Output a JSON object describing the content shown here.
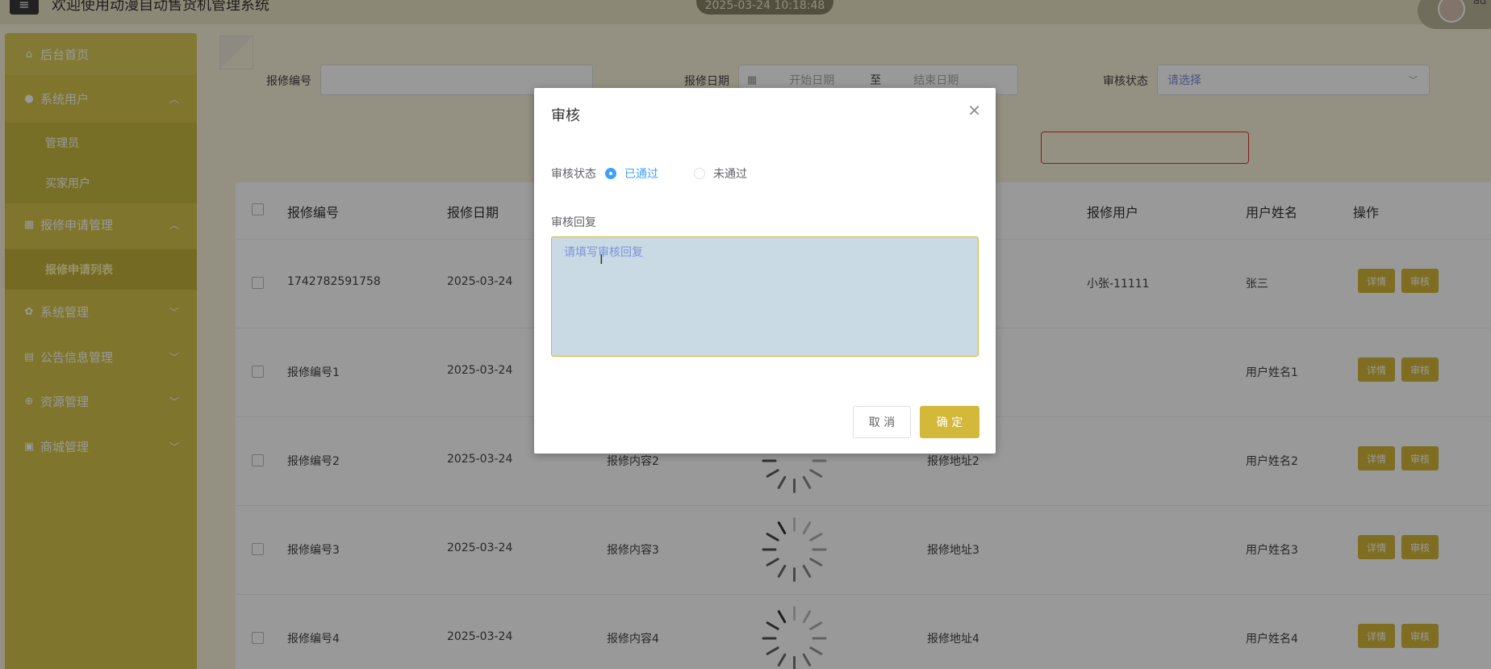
{
  "header": {
    "menu_icon": "menu-icon",
    "welcome": "欢迎使用动漫自动售货机管理系统",
    "datetime": "2025-03-24 10:18:48",
    "user_name": "ad"
  },
  "sidebar": {
    "items": [
      {
        "label": "后台首页",
        "icon": "home-icon"
      },
      {
        "label": "系统用户",
        "icon": "user-icon"
      },
      {
        "label": "管理员"
      },
      {
        "label": "买家用户"
      },
      {
        "label": "报修申请管理",
        "icon": "grid-icon"
      },
      {
        "label": "报修申请列表"
      },
      {
        "label": "系统管理",
        "icon": "gear-icon"
      },
      {
        "label": "公告信息管理",
        "icon": "doc-icon"
      },
      {
        "label": "资源管理",
        "icon": "plus-circle-icon"
      },
      {
        "label": "商城管理",
        "icon": "shop-icon"
      }
    ]
  },
  "filters": {
    "repair_no_label": "报修编号",
    "repair_date_label": "报修日期",
    "start_placeholder": "开始日期",
    "to": "至",
    "end_placeholder": "结束日期",
    "status_label": "审核状态",
    "status_placeholder": "请选择"
  },
  "table": {
    "headers": [
      "报修编号",
      "报修日期",
      "报修用户",
      "用户姓名",
      "操作"
    ],
    "rows": [
      {
        "no": "1742782591758",
        "date": "2025-03-24",
        "content": "",
        "address": "",
        "user": "小张-11111",
        "name": "张三"
      },
      {
        "no": "报修编号1",
        "date": "2025-03-24",
        "content": "",
        "address": "",
        "user": "",
        "name": "用户姓名1"
      },
      {
        "no": "报修编号2",
        "date": "2025-03-24",
        "content": "报修内容2",
        "address": "报修地址2",
        "user": "",
        "name": "用户姓名2"
      },
      {
        "no": "报修编号3",
        "date": "2025-03-24",
        "content": "报修内容3",
        "address": "报修地址3",
        "user": "",
        "name": "用户姓名3"
      },
      {
        "no": "报修编号4",
        "date": "2025-03-24",
        "content": "报修内容4",
        "address": "报修地址4",
        "user": "",
        "name": "用户姓名4"
      }
    ],
    "detail_label": "详情",
    "audit_label": "审核"
  },
  "modal": {
    "title": "审核",
    "status_label": "审核状态",
    "option_pass": "已通过",
    "option_fail": "未通过",
    "reply_label": "审核回复",
    "reply_placeholder": "请填写审核回复",
    "cancel": "取 消",
    "confirm": "确 定"
  }
}
